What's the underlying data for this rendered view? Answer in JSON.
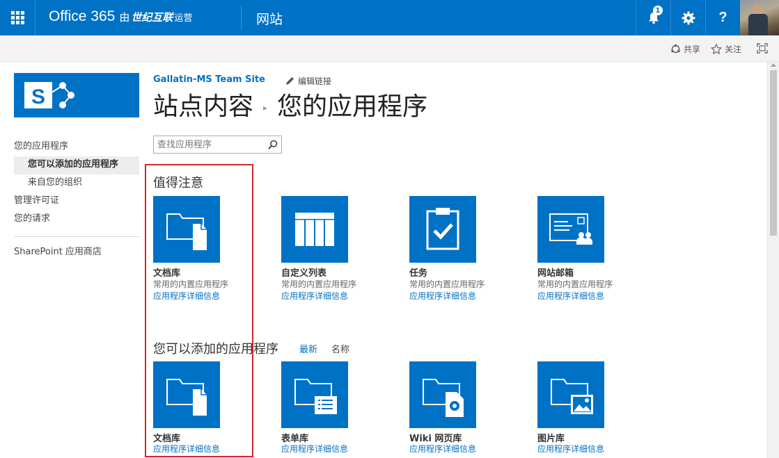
{
  "suite_bar": {
    "brand_main": "Office 365",
    "brand_by": "由",
    "brand_operator": "世纪互联",
    "brand_operator_suffix": "运营",
    "site_link": "网站",
    "notification_count": "1",
    "help_label": "?"
  },
  "ribbon": {
    "share": "共享",
    "follow": "关注"
  },
  "left_nav": {
    "items": [
      {
        "label": "您的应用程序"
      },
      {
        "label": "您可以添加的应用程序"
      },
      {
        "label": "来自您的组织"
      },
      {
        "label": "管理许可证"
      },
      {
        "label": "您的请求"
      }
    ],
    "store": "SharePoint 应用商店"
  },
  "header": {
    "site_title": "Gallatin-MS Team Site",
    "edit_links": "编辑链接",
    "breadcrumb_root": "站点内容",
    "breadcrumb_current": "您的应用程序"
  },
  "search": {
    "placeholder": "查找应用程序"
  },
  "noteworthy": {
    "heading": "值得注意",
    "tiles": [
      {
        "name": "文档库",
        "desc": "常用的内置应用程序",
        "link": "应用程序详细信息",
        "icon": "document-library-icon"
      },
      {
        "name": "自定义列表",
        "desc": "常用的内置应用程序",
        "link": "应用程序详细信息",
        "icon": "custom-list-icon"
      },
      {
        "name": "任务",
        "desc": "常用的内置应用程序",
        "link": "应用程序详细信息",
        "icon": "tasks-icon"
      },
      {
        "name": "网站邮箱",
        "desc": "常用的内置应用程序",
        "link": "应用程序详细信息",
        "icon": "site-mailbox-icon"
      }
    ]
  },
  "addable": {
    "heading": "您可以添加的应用程序",
    "sort_newest": "最新",
    "sort_name": "名称",
    "tiles": [
      {
        "name": "文档库",
        "link": "应用程序详细信息",
        "icon": "document-library-icon"
      },
      {
        "name": "表单库",
        "link": "应用程序详细信息",
        "icon": "form-library-icon"
      },
      {
        "name": "Wiki 网页库",
        "link": "应用程序详细信息",
        "icon": "wiki-page-library-icon"
      },
      {
        "name": "图片库",
        "link": "应用程序详细信息",
        "icon": "picture-library-icon"
      }
    ]
  },
  "colors": {
    "brand_blue": "#0072c6",
    "highlight_red": "#d0262c"
  }
}
